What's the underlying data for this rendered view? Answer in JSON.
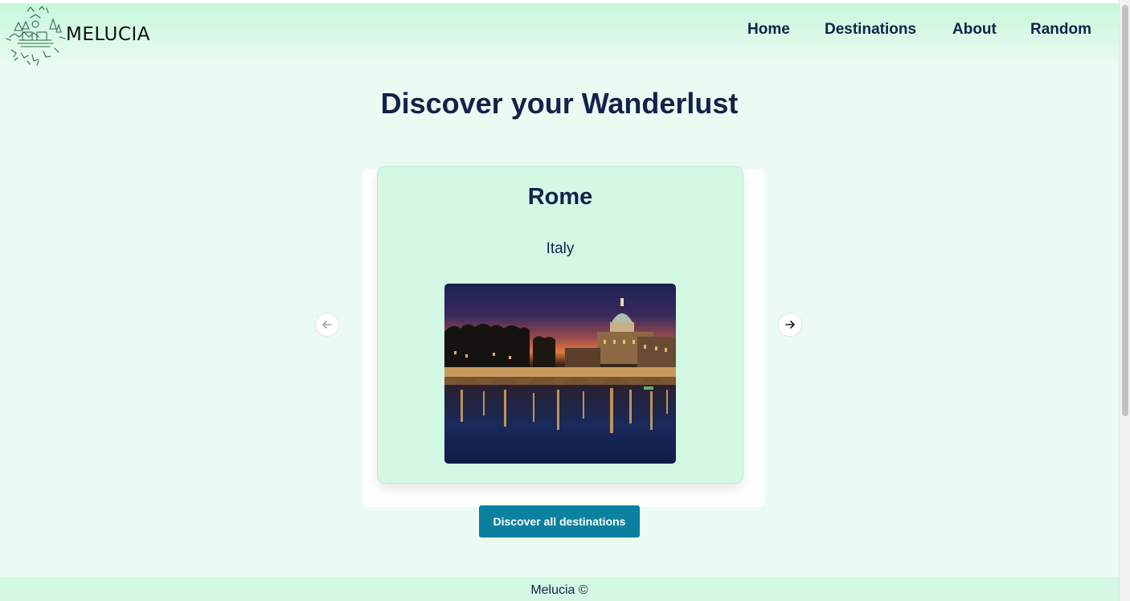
{
  "brand": {
    "name": "MELUCIA"
  },
  "nav": {
    "home": "Home",
    "destinations": "Destinations",
    "about": "About",
    "random": "Random"
  },
  "hero": {
    "title": "Discover your Wanderlust"
  },
  "carousel": {
    "city": "Rome",
    "country": "Italy",
    "prev_icon": "arrow-left-icon",
    "next_icon": "arrow-right-icon"
  },
  "cta": {
    "label": "Discover all destinations"
  },
  "footer": {
    "text": "Melucia ©"
  },
  "colors": {
    "page_background": "#ebfbf1",
    "card_background": "#d3f8e4",
    "heading": "#12224a",
    "button": "#0a819e"
  }
}
